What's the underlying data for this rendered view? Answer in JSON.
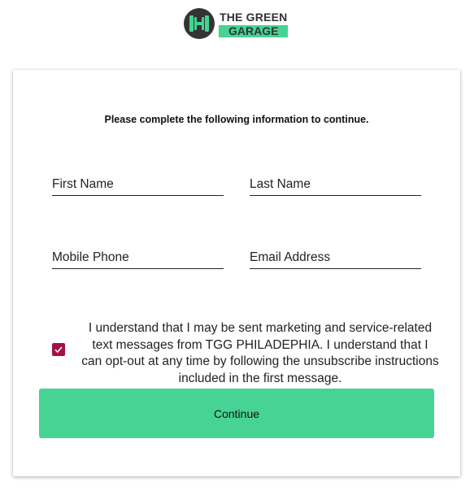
{
  "brand": {
    "name_line1": "THE GREEN",
    "name_line2": "GARAGE",
    "accent": "#46d393",
    "logo_icon": "dumbbell-h-icon"
  },
  "form": {
    "heading": "Please complete the following information to continue.",
    "fields": [
      {
        "label": "First Name"
      },
      {
        "label": "Last Name"
      },
      {
        "label": "Mobile Phone"
      },
      {
        "label": "Email Address"
      }
    ],
    "consent": {
      "checked": true,
      "text": "I understand that I may be sent marketing and service-related text messages from TGG PHILADEPHIA. I understand that I can opt-out at any time by following the unsubscribe instructions included in the first message."
    },
    "continue_label": "Continue"
  }
}
